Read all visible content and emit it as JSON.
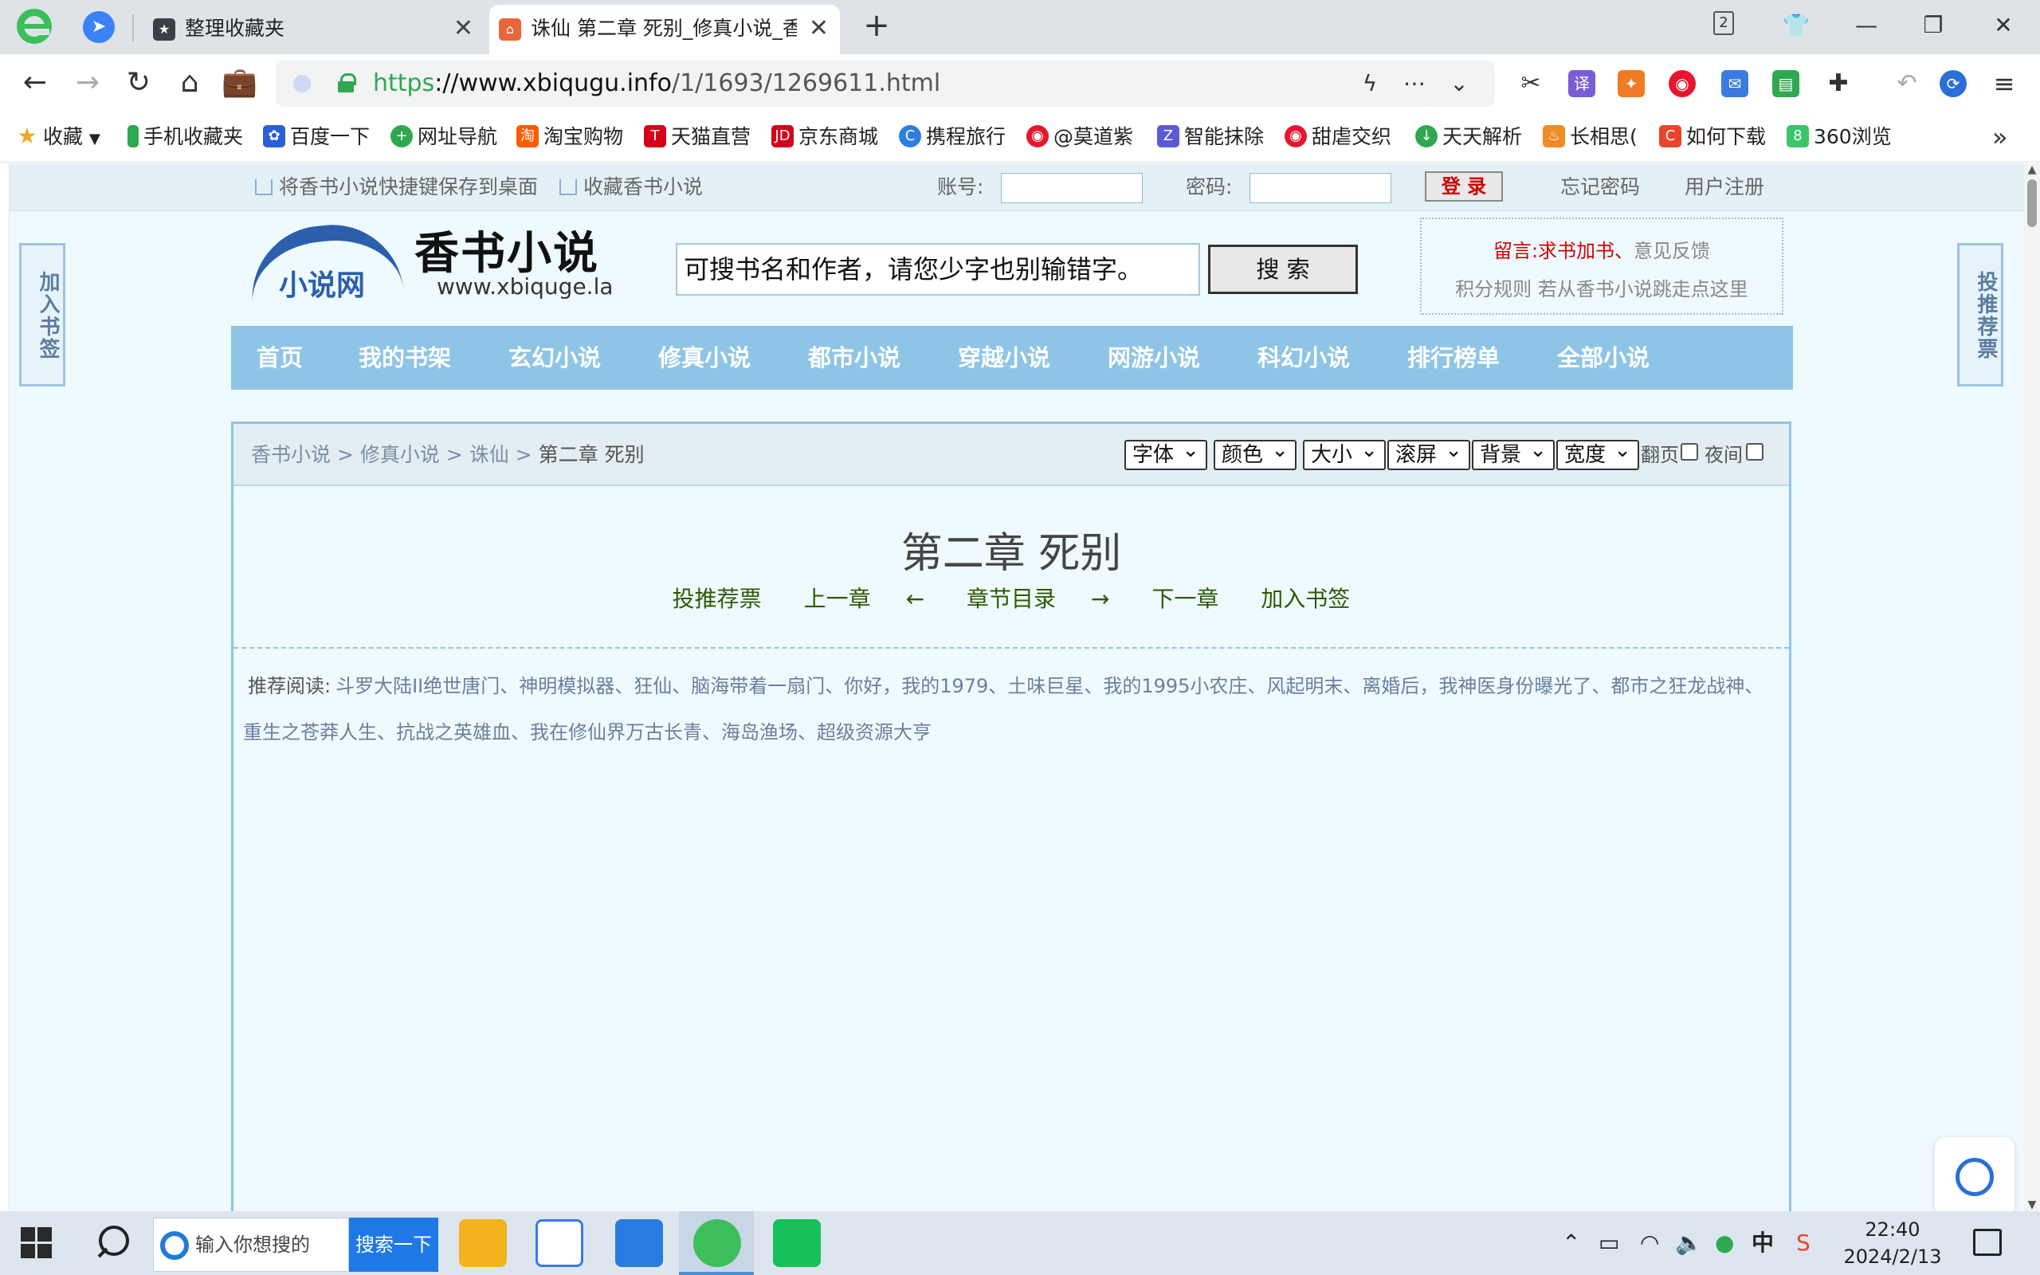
{
  "browser": {
    "pinned_tab_icon": "send-icon",
    "tabs": [
      {
        "title": "整理收藏夹",
        "icon": "star-icon"
      },
      {
        "title": "诛仙 第二章 死别_修真小说_香",
        "icon": "house-icon"
      }
    ],
    "tab_count": "2",
    "url": {
      "scheme": "https",
      "host": "://www.xbiqugu.info",
      "path": "/1/1693/1269611.html"
    }
  },
  "bookmarks": [
    {
      "label": "收藏",
      "icon": "star-icon",
      "color": "#f5a623"
    },
    {
      "label": "手机收藏夹",
      "icon": "phone-icon",
      "color": "#2fa84f"
    },
    {
      "label": "百度一下",
      "icon": "baidu-icon",
      "color": "#2b5fd6"
    },
    {
      "label": "网址导航",
      "icon": "plus-icon",
      "color": "#2fa84f"
    },
    {
      "label": "淘宝购物",
      "icon": "taobao-icon",
      "color": "#ff5a00"
    },
    {
      "label": "天猫直营",
      "icon": "tmall-icon",
      "color": "#d4001a"
    },
    {
      "label": "京东商城",
      "icon": "jd-icon",
      "color": "#d4001a"
    },
    {
      "label": "携程旅行",
      "icon": "ctrip-icon",
      "color": "#2b7de0"
    },
    {
      "label": "@莫道紫",
      "icon": "weibo-icon",
      "color": "#e6162d"
    },
    {
      "label": "智能抹除",
      "icon": "z-icon",
      "color": "#5b5bd6"
    },
    {
      "label": "甜虐交织",
      "icon": "weibo-icon",
      "color": "#e6162d"
    },
    {
      "label": "天天解析",
      "icon": "download-icon",
      "color": "#2fa84f"
    },
    {
      "label": "长相思(",
      "icon": "flame-icon",
      "color": "#f08a24"
    },
    {
      "label": "如何下载",
      "icon": "c-icon",
      "color": "#e8452c"
    },
    {
      "label": "360浏览",
      "icon": "eight-icon",
      "color": "#3cc46b"
    }
  ],
  "site": {
    "topbar": {
      "save_shortcut": "将香书小说快捷键保存到桌面",
      "favorite": "收藏香书小说",
      "account_label": "账号:",
      "password_label": "密码:",
      "login": "登 录",
      "forgot": "忘记密码",
      "register": "用户注册"
    },
    "left_badge": "加入书签",
    "right_badge": "投推荐票",
    "logo": {
      "small": "小说网",
      "big": "香书小说",
      "url": "www.xbiquge.la"
    },
    "search": {
      "value": "可搜书名和作者，请您少字也别输错字。",
      "button": "搜 索"
    },
    "note": {
      "prefix": "留言:",
      "request": "求书加书",
      "sep": "、",
      "feedback": "意见反馈",
      "rules": "积分规则",
      "escape": "若从香书小说跳走点这里"
    },
    "nav": [
      "首页",
      "我的书架",
      "玄幻小说",
      "修真小说",
      "都市小说",
      "穿越小说",
      "网游小说",
      "科幻小说",
      "排行榜单",
      "全部小说"
    ]
  },
  "reader": {
    "breadcrumb": [
      {
        "label": "香书小说"
      },
      {
        "sep": ">"
      },
      {
        "label": "修真小说"
      },
      {
        "sep": ">"
      },
      {
        "label": "诛仙"
      },
      {
        "sep": ">"
      },
      {
        "label": "第二章 死别"
      }
    ],
    "controls": [
      "字体",
      "颜色",
      "大小",
      "滚屏",
      "背景",
      "宽度"
    ],
    "page_turn": "翻页",
    "night": "夜间",
    "title": "第二章 死别",
    "chapter_nav": {
      "vote": "投推荐票",
      "prev": "上一章",
      "left_arrow": "←",
      "toc": "章节目录",
      "right_arrow": "→",
      "next": "下一章",
      "bookmark": "加入书签"
    },
    "recommend_label": "推荐阅读:",
    "recommend_text": "斗罗大陆II绝世唐门、神明模拟器、狂仙、脑海带着一扇门、你好，我的1979、土味巨星、我的1995小农庄、风起明末、离婚后，我神医身份曝光了、都市之狂龙战神、重生之苍莽人生、抗战之英雄血、我在修仙界万古长青、海岛渔场、超级资源大亨"
  },
  "taskbar": {
    "search_placeholder": "输入你想搜的",
    "search_button": "搜索一下",
    "ime": "中",
    "time": "22:40",
    "date": "2024/2/13"
  }
}
